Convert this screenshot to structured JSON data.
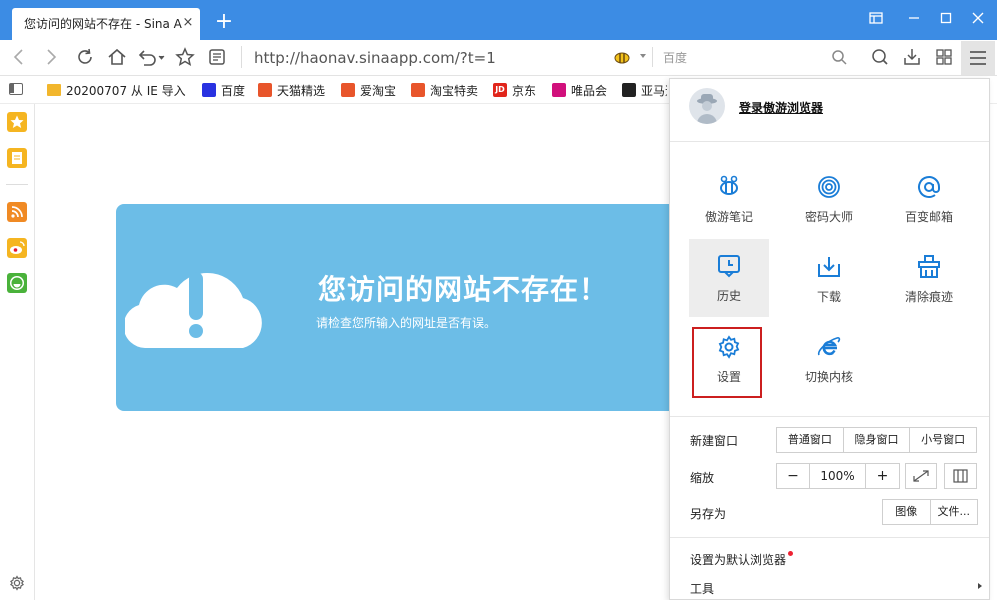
{
  "tab": {
    "title": "您访问的网站不存在 - Sina A",
    "close": "×",
    "new_tab": "+"
  },
  "address": {
    "url": "http://haonav.sinaapp.com/?t=1"
  },
  "search": {
    "placeholder": "百度"
  },
  "bookmarks": [
    {
      "label": "20200707 从 IE 导入",
      "icon": "folder-icon",
      "color": "#f2b62c"
    },
    {
      "label": "百度",
      "icon": "baidu-icon",
      "color": "#2932e1"
    },
    {
      "label": "天猫精选",
      "icon": "taobao-icon",
      "color": "#e8552b"
    },
    {
      "label": "爱淘宝",
      "icon": "taobao-icon",
      "color": "#e8552b"
    },
    {
      "label": "淘宝特卖",
      "icon": "taobao-icon",
      "color": "#e8552b"
    },
    {
      "label": "京东",
      "icon": "jd-icon",
      "color": "#e1251b"
    },
    {
      "label": "唯品会",
      "icon": "vip-icon",
      "color": "#d1107c"
    },
    {
      "label": "亚马逊",
      "icon": "amazon-icon",
      "color": "#222222"
    }
  ],
  "jd_glyph": "JD",
  "error": {
    "title": "您访问的网站不存在！",
    "subtitle": "请检查您所输入的网址是否有误。"
  },
  "menu": {
    "login": "登录傲游浏览器",
    "items": [
      {
        "label": "傲游笔记",
        "icon": "bee-note-icon"
      },
      {
        "label": "密码大师",
        "icon": "fingerprint-icon"
      },
      {
        "label": "百变邮箱",
        "icon": "mail-at-icon"
      },
      {
        "label": "历史",
        "icon": "history-icon"
      },
      {
        "label": "下载",
        "icon": "download-icon"
      },
      {
        "label": "清除痕迹",
        "icon": "broom-icon"
      },
      {
        "label": "设置",
        "icon": "gear-icon"
      },
      {
        "label": "切换内核",
        "icon": "ie-icon"
      }
    ],
    "new_window": {
      "label": "新建窗口",
      "options": [
        "普通窗口",
        "隐身窗口",
        "小号窗口"
      ]
    },
    "zoom": {
      "label": "缩放",
      "minus": "−",
      "value": "100%",
      "plus": "+"
    },
    "save_as": {
      "label": "另存为",
      "options": [
        "图像",
        "文件..."
      ]
    },
    "default_browser": "设置为默认浏览器",
    "tools": "工具"
  },
  "colors": {
    "accent": "#3c8ce4",
    "icon_blue": "#1a7dd7",
    "error_bg": "#6cbde7",
    "highlight": "#cc1f1f"
  }
}
